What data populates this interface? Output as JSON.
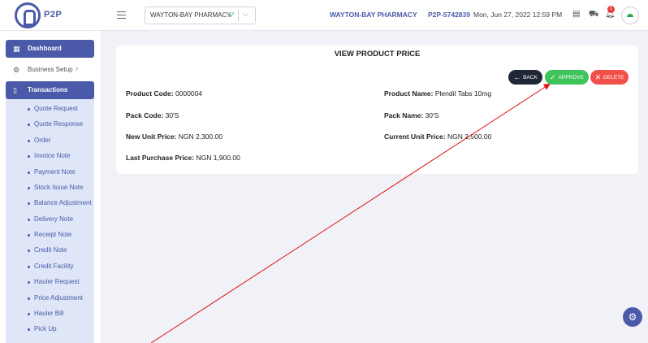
{
  "header": {
    "logo_text": "P2P",
    "pharmacy_select": {
      "value": "WAYTON-BAY PHARMACY"
    },
    "pharmacy_name": "WAYTON-BAY PHARMACY",
    "account_code": "P2P-5742839",
    "datetime": "Mon, Jun 27, 2022 12:59 PM",
    "notification_count": "1"
  },
  "sidebar": {
    "dashboard": "Dashboard",
    "business_setup": "Business Setup",
    "transactions": "Transactions",
    "items": [
      "Quote Request",
      "Quote Response",
      "Order",
      "Invoice Note",
      "Payment Note",
      "Stock Issue Note",
      "Balance Adjustment",
      "Delivery Note",
      "Receipt Note",
      "Credit Note",
      "Credit Facility",
      "Hauler Request",
      "Price Adjustment",
      "Hauler Bill",
      "Pick Up"
    ]
  },
  "card": {
    "title": "VIEW PRODUCT PRICE",
    "back_label": "BACK",
    "approve_label": "APPROVE",
    "delete_label": "DELETE",
    "product_code_label": "Product Code:",
    "product_code": "0000004",
    "product_name_label": "Product Name:",
    "product_name": "Plendil Tabs 10mg",
    "pack_code_label": "Pack Code:",
    "pack_code": "30'S",
    "pack_name_label": "Pack Name:",
    "pack_name": "30'S",
    "new_unit_price_label": "New Unit Price:",
    "new_unit_price": "NGN 2,300.00",
    "current_unit_price_label": "Current Unit Price:",
    "current_unit_price": "NGN 2,500.00",
    "last_purchase_price_label": "Last Purchase Price:",
    "last_purchase_price": "NGN 1,900.00"
  },
  "colors": {
    "brand": "#4a5aa8",
    "approve": "#3ec45a",
    "delete": "#f0504a",
    "back": "#1f2736",
    "annotation_arrow": "#e01010"
  }
}
